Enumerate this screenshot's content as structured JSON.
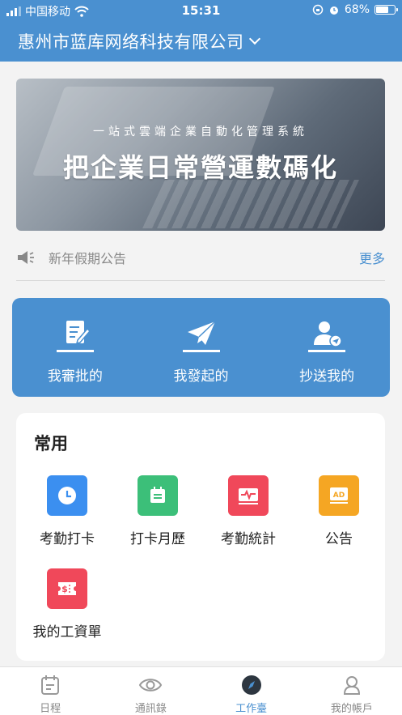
{
  "status_bar": {
    "carrier": "中国移动",
    "time": "15:31",
    "battery": "68%",
    "battery_level": 0.68
  },
  "header": {
    "company": "惠州市蓝库网络科技有限公司"
  },
  "banner": {
    "subtitle": "一站式雲端企業自動化管理系統",
    "title": "把企業日常營運數碼化"
  },
  "notice": {
    "text": "新年假期公告",
    "more": "更多"
  },
  "actions": [
    {
      "label": "我審批的",
      "icon": "edit-document-icon"
    },
    {
      "label": "我發起的",
      "icon": "paper-plane-icon"
    },
    {
      "label": "抄送我的",
      "icon": "user-send-icon"
    }
  ],
  "common": {
    "title": "常用",
    "items": [
      {
        "label": "考勤打卡",
        "icon": "clock-icon",
        "color": "#3b8ff0"
      },
      {
        "label": "打卡月歷",
        "icon": "calendar-icon",
        "color": "#3cbf79"
      },
      {
        "label": "考勤統計",
        "icon": "pulse-chart-icon",
        "color": "#f0485a"
      },
      {
        "label": "公告",
        "icon": "ad-board-icon",
        "color": "#f5a623"
      },
      {
        "label": "我的工資單",
        "icon": "salary-ticket-icon",
        "color": "#f0485a"
      }
    ]
  },
  "tabs": [
    {
      "label": "日程",
      "icon": "calendar-tab-icon",
      "active": false
    },
    {
      "label": "通訊錄",
      "icon": "eye-icon",
      "active": false
    },
    {
      "label": "工作臺",
      "icon": "compass-icon",
      "active": true
    },
    {
      "label": "我的帳戶",
      "icon": "user-icon",
      "active": false
    }
  ],
  "colors": {
    "primary": "#4a90d0",
    "background": "#f3f3f3"
  }
}
